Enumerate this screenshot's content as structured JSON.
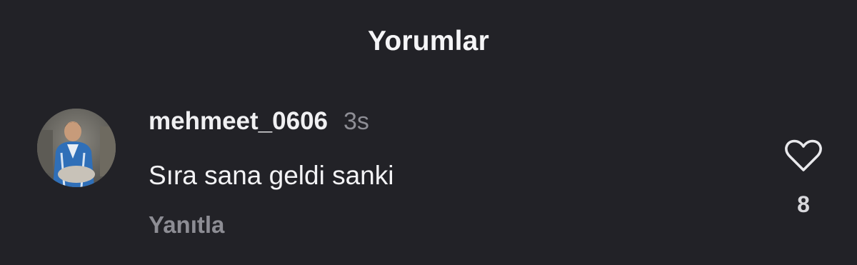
{
  "header": {
    "title": "Yorumlar"
  },
  "comment": {
    "username": "mehmeet_0606",
    "time": "3s",
    "text": "Sıra sana geldi sanki",
    "reply_label": "Yanıtla",
    "like_count": "8",
    "like_icon": "heart-outline-icon"
  },
  "colors": {
    "background": "#222227",
    "primary_text": "#f2f2f4",
    "secondary_text": "#8e8e95"
  }
}
